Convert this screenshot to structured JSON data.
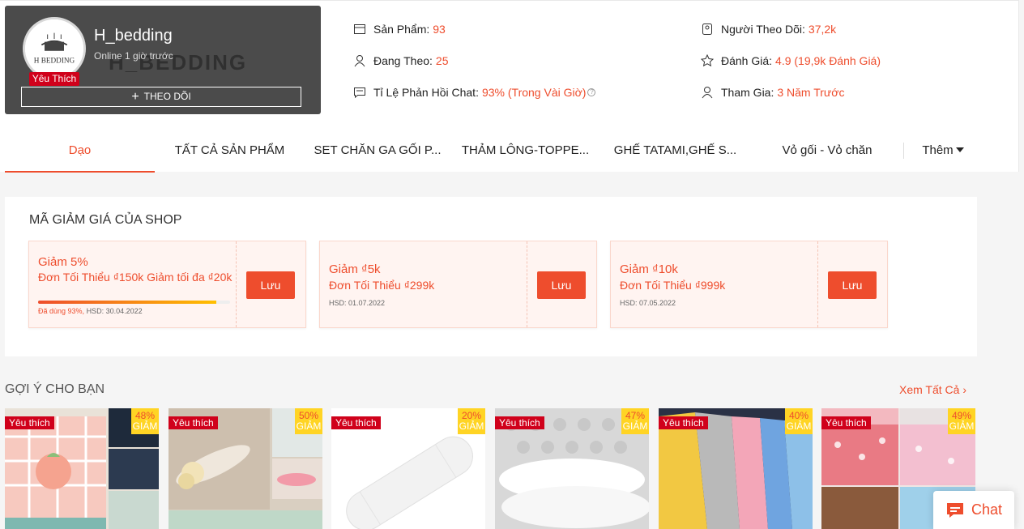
{
  "shop": {
    "name": "H_bedding",
    "status": "Online 1 giờ trước",
    "badge": "Yêu Thích",
    "follow_label": "THEO DÕI",
    "avatar_text": "H BEDDING",
    "banner_text": "H_BEDDING"
  },
  "stats": {
    "products_label": "Sản Phẩm:",
    "products_value": "93",
    "following_label": "Đang Theo:",
    "following_value": "25",
    "chat_rate_label": "Tỉ Lệ Phản Hồi Chat:",
    "chat_rate_value": "93% (Trong Vài Giờ)",
    "followers_label": "Người Theo Dõi:",
    "followers_value": "37,2k",
    "rating_label": "Đánh Giá:",
    "rating_value": "4.9 (19,9k Đánh Giá)",
    "joined_label": "Tham Gia:",
    "joined_value": "3 Năm Trước"
  },
  "nav": {
    "items": [
      "Dạo",
      "TẤT CẢ SẢN PHẨM",
      "SET CHĂN GA GỐI P...",
      "THẢM LÔNG-TOPPE...",
      "GHẾ TATAMI,GHẾ S...",
      "Vỏ gối - Vỏ chăn"
    ],
    "more": "Thêm"
  },
  "vouchers": {
    "title": "MÃ GIẢM GIÁ CỦA SHOP",
    "items": [
      {
        "head": "Giảm 5%",
        "sub": "Đơn Tối Thiểu ₫150k Giảm tối đa ₫20k",
        "used": "Đã dùng 93%,",
        "expiry": "HSD: 30.04.2022",
        "button": "Lưu",
        "progress": 0.93
      },
      {
        "head": "Giảm ₫5k",
        "sub": "Đơn Tối Thiểu ₫299k",
        "expiry": "HSD: 01.07.2022",
        "button": "Lưu"
      },
      {
        "head": "Giảm ₫10k",
        "sub": "Đơn Tối Thiểu ₫999k",
        "expiry": "HSD: 07.05.2022",
        "button": "Lưu"
      }
    ]
  },
  "suggestions": {
    "title": "GỢI Ý CHO BẠN",
    "see_all": "Xem Tất Cả",
    "badge": "Yêu thích",
    "giam": "GIẢM",
    "products": [
      {
        "discount": "48%"
      },
      {
        "discount": "50%"
      },
      {
        "discount": "20%"
      },
      {
        "discount": "47%"
      },
      {
        "discount": "40%"
      },
      {
        "discount": "49%"
      }
    ]
  },
  "chat": {
    "label": "Chat"
  },
  "colors": {
    "accent": "#ee4d2d",
    "badge": "#d0011b",
    "discount": "#ffd424"
  }
}
